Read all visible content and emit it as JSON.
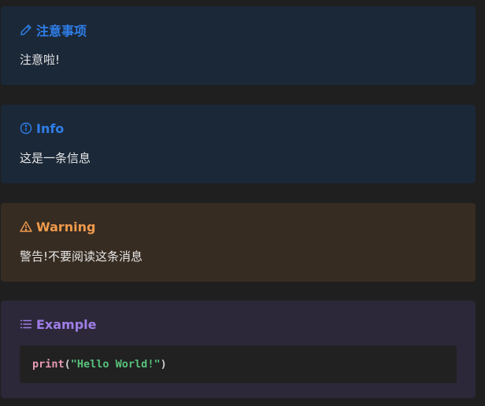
{
  "colors": {
    "page_bg": "#1f1f1f",
    "note_bg": "#1b2838",
    "note_accent": "#2f7ee8",
    "info_bg": "#1b2838",
    "info_accent": "#2f7ee8",
    "warning_bg": "#372c22",
    "warning_accent": "#ef9a4c",
    "example_bg": "#2c2839",
    "example_accent": "#a07ee8"
  },
  "note": {
    "icon": "pencil-icon",
    "title": "注意事项",
    "body": "注意啦!"
  },
  "info": {
    "icon": "info-circle-icon",
    "title": "Info",
    "body": "这是一条信息"
  },
  "warning": {
    "icon": "warning-triangle-icon",
    "title": "Warning",
    "body": "警告!不要阅读这条消息"
  },
  "example": {
    "icon": "list-icon",
    "title": "Example",
    "code": {
      "fn": "print",
      "open": "(",
      "str": "\"Hello World!\"",
      "close": ")"
    }
  }
}
